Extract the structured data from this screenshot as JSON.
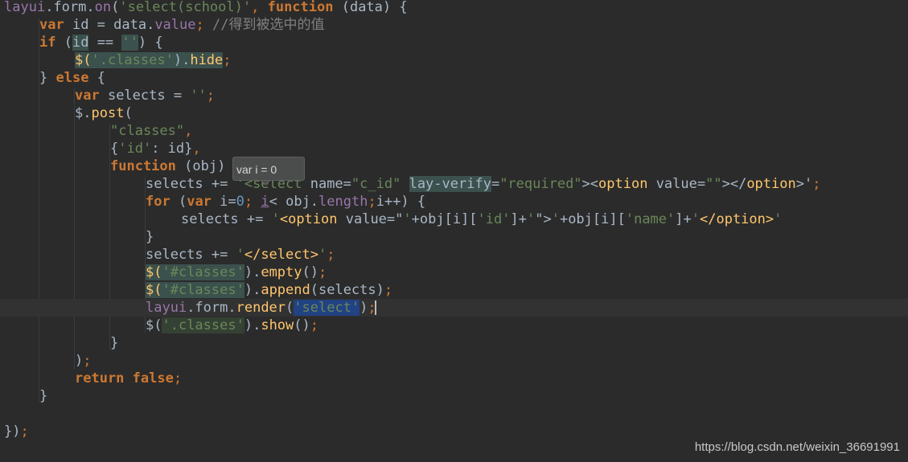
{
  "editor": {
    "colors": {
      "background": "#2b2b2b",
      "current_line": "#323232",
      "keyword": "#cc7832",
      "string": "#6a8759",
      "plain": "#a9b7c6",
      "member": "#9876aa",
      "function_call": "#ffc66d",
      "comment": "#808080",
      "number": "#6897bb",
      "usage_highlight": "#3b514d",
      "selection": "#214283",
      "caret_match": "#344134"
    },
    "current_line_index": 17,
    "lines": [
      {
        "indent": 0,
        "tokens": [
          {
            "t": "layui",
            "c": "member"
          },
          {
            "t": ".form.",
            "c": "plain"
          },
          {
            "t": "on",
            "c": "member"
          },
          {
            "t": "(",
            "c": "plain"
          },
          {
            "t": "'select(school)'",
            "c": "string"
          },
          {
            "t": ", ",
            "c": "keyword"
          },
          {
            "t": "function",
            "c": "keyword"
          },
          {
            "t": " (data) {",
            "c": "plain"
          }
        ]
      },
      {
        "indent": 1,
        "tokens": [
          {
            "t": "var",
            "c": "keyword"
          },
          {
            "t": " id = data.",
            "c": "plain"
          },
          {
            "t": "value",
            "c": "member"
          },
          {
            "t": "; ",
            "c": "keyword"
          },
          {
            "t": "//得到被选中的值",
            "c": "comment"
          }
        ]
      },
      {
        "indent": 1,
        "tokens": [
          {
            "t": "if",
            "c": "keyword"
          },
          {
            "t": " (",
            "c": "plain"
          },
          {
            "t": "id",
            "c": "plain",
            "hl": "usage"
          },
          {
            "t": " == ",
            "c": "plain"
          },
          {
            "t": "''",
            "c": "string",
            "hl": "usage"
          },
          {
            "t": ") {",
            "c": "plain"
          }
        ]
      },
      {
        "indent": 2,
        "tokens": [
          {
            "t": "$(",
            "c": "function_call",
            "hl": "usage"
          },
          {
            "t": "'.classes'",
            "c": "string",
            "hl": "usage"
          },
          {
            "t": ").",
            "c": "plain",
            "hl": "usage"
          },
          {
            "t": "hide",
            "c": "function_call",
            "hl": "usage"
          },
          {
            "t": ";",
            "c": "keyword"
          }
        ]
      },
      {
        "indent": 1,
        "tokens": [
          {
            "t": "} ",
            "c": "plain"
          },
          {
            "t": "else",
            "c": "keyword"
          },
          {
            "t": " {",
            "c": "plain"
          }
        ]
      },
      {
        "indent": 2,
        "tokens": [
          {
            "t": "var",
            "c": "keyword"
          },
          {
            "t": " selects = ",
            "c": "plain"
          },
          {
            "t": "''",
            "c": "string"
          },
          {
            "t": ";",
            "c": "keyword"
          }
        ]
      },
      {
        "indent": 2,
        "tokens": [
          {
            "t": "$.",
            "c": "plain"
          },
          {
            "t": "post",
            "c": "function_call"
          },
          {
            "t": "(",
            "c": "plain"
          }
        ]
      },
      {
        "indent": 3,
        "tokens": [
          {
            "t": "\"classes\"",
            "c": "string"
          },
          {
            "t": ",",
            "c": "keyword"
          }
        ]
      },
      {
        "indent": 3,
        "tokens": [
          {
            "t": "{",
            "c": "plain"
          },
          {
            "t": "'id'",
            "c": "string"
          },
          {
            "t": ": id}",
            "c": "plain"
          },
          {
            "t": ",",
            "c": "keyword"
          }
        ]
      },
      {
        "indent": 3,
        "tokens": [
          {
            "t": "function",
            "c": "keyword"
          },
          {
            "t": " (obj) {",
            "c": "plain"
          }
        ]
      },
      {
        "indent": 4,
        "tokens": [
          {
            "t": "selects += ",
            "c": "plain"
          },
          {
            "t": "'<select ",
            "c": "string"
          },
          {
            "t": "name=",
            "c": "plain"
          },
          {
            "t": "\"c_id\"",
            "c": "string"
          },
          {
            "t": " ",
            "c": "plain"
          },
          {
            "t": "lay-verify",
            "c": "plain",
            "hl": "usage"
          },
          {
            "t": "=",
            "c": "plain"
          },
          {
            "t": "\"required\"",
            "c": "string"
          },
          {
            "t": "><",
            "c": "plain"
          },
          {
            "t": "option",
            "c": "function_call"
          },
          {
            "t": " value=",
            "c": "plain"
          },
          {
            "t": "\"\"",
            "c": "string"
          },
          {
            "t": "></",
            "c": "plain"
          },
          {
            "t": "option",
            "c": "function_call"
          },
          {
            "t": ">'",
            "c": "plain"
          },
          {
            "t": ";",
            "c": "keyword"
          }
        ]
      },
      {
        "indent": 4,
        "tokens": [
          {
            "t": "for",
            "c": "keyword"
          },
          {
            "t": " (",
            "c": "plain"
          },
          {
            "t": "var",
            "c": "keyword"
          },
          {
            "t": " i=",
            "c": "plain"
          },
          {
            "t": "0",
            "c": "number"
          },
          {
            "t": "; ",
            "c": "keyword"
          },
          {
            "t": "i",
            "c": "member",
            "hl": "underline"
          },
          {
            "t": "< obj.",
            "c": "plain"
          },
          {
            "t": "length",
            "c": "member"
          },
          {
            "t": ";",
            "c": "keyword"
          },
          {
            "t": "i++) {",
            "c": "plain"
          }
        ]
      },
      {
        "indent": 5,
        "tokens": [
          {
            "t": "selects += ",
            "c": "plain"
          },
          {
            "t": "'",
            "c": "string"
          },
          {
            "t": "<option",
            "c": "function_call"
          },
          {
            "t": " value=\"",
            "c": "plain"
          },
          {
            "t": "'",
            "c": "string"
          },
          {
            "t": "+obj[i][",
            "c": "plain"
          },
          {
            "t": "'id'",
            "c": "string"
          },
          {
            "t": "]+",
            "c": "plain"
          },
          {
            "t": "'",
            "c": "string"
          },
          {
            "t": "\">",
            "c": "plain"
          },
          {
            "t": "'",
            "c": "string"
          },
          {
            "t": "+obj[i][",
            "c": "plain"
          },
          {
            "t": "'name'",
            "c": "string"
          },
          {
            "t": "]+",
            "c": "plain"
          },
          {
            "t": "'",
            "c": "string"
          },
          {
            "t": "</option>",
            "c": "function_call"
          },
          {
            "t": "'",
            "c": "string"
          }
        ]
      },
      {
        "indent": 4,
        "tokens": [
          {
            "t": "}",
            "c": "plain"
          }
        ]
      },
      {
        "indent": 4,
        "tokens": [
          {
            "t": "selects += ",
            "c": "plain"
          },
          {
            "t": "'",
            "c": "string"
          },
          {
            "t": "</select>",
            "c": "function_call"
          },
          {
            "t": "'",
            "c": "string"
          },
          {
            "t": ";",
            "c": "keyword"
          }
        ]
      },
      {
        "indent": 4,
        "tokens": [
          {
            "t": "$(",
            "c": "function_call",
            "hl": "usage"
          },
          {
            "t": "'#classes'",
            "c": "string",
            "hl": "usage"
          },
          {
            "t": ").",
            "c": "plain"
          },
          {
            "t": "empty",
            "c": "function_call"
          },
          {
            "t": "()",
            "c": "plain"
          },
          {
            "t": ";",
            "c": "keyword"
          }
        ]
      },
      {
        "indent": 4,
        "tokens": [
          {
            "t": "$(",
            "c": "function_call",
            "hl": "usage"
          },
          {
            "t": "'#classes'",
            "c": "string",
            "hl": "usage"
          },
          {
            "t": ").",
            "c": "plain"
          },
          {
            "t": "append",
            "c": "function_call"
          },
          {
            "t": "(selects)",
            "c": "plain"
          },
          {
            "t": ";",
            "c": "keyword"
          }
        ]
      },
      {
        "indent": 4,
        "tokens": [
          {
            "t": "layui",
            "c": "member"
          },
          {
            "t": ".form.",
            "c": "plain"
          },
          {
            "t": "render",
            "c": "function_call"
          },
          {
            "t": "(",
            "c": "plain"
          },
          {
            "t": "'select'",
            "c": "string",
            "hl": "selection"
          },
          {
            "t": ")",
            "c": "plain"
          },
          {
            "t": ";",
            "c": "keyword"
          }
        ]
      },
      {
        "indent": 4,
        "tokens": [
          {
            "t": "$(",
            "c": "plain"
          },
          {
            "t": "'.classes'",
            "c": "string",
            "hl": "caret"
          },
          {
            "t": ").",
            "c": "plain"
          },
          {
            "t": "show",
            "c": "function_call"
          },
          {
            "t": "()",
            "c": "plain"
          },
          {
            "t": ";",
            "c": "keyword"
          }
        ]
      },
      {
        "indent": 3,
        "tokens": [
          {
            "t": "}",
            "c": "plain"
          }
        ]
      },
      {
        "indent": 2,
        "tokens": [
          {
            "t": ")",
            "c": "plain"
          },
          {
            "t": ";",
            "c": "keyword"
          }
        ]
      },
      {
        "indent": 2,
        "tokens": [
          {
            "t": "return false",
            "c": "keyword"
          },
          {
            "t": ";",
            "c": "keyword"
          }
        ]
      },
      {
        "indent": 1,
        "tokens": [
          {
            "t": "}",
            "c": "plain"
          }
        ]
      },
      {
        "indent": 0,
        "tokens": []
      },
      {
        "indent": 0,
        "tokens": [
          {
            "t": "})",
            "c": "plain"
          },
          {
            "t": ";",
            "c": "keyword"
          }
        ]
      }
    ]
  },
  "tooltip": {
    "text": "var i = 0"
  },
  "watermark": {
    "text": "https://blog.csdn.net/weixin_36691991"
  }
}
